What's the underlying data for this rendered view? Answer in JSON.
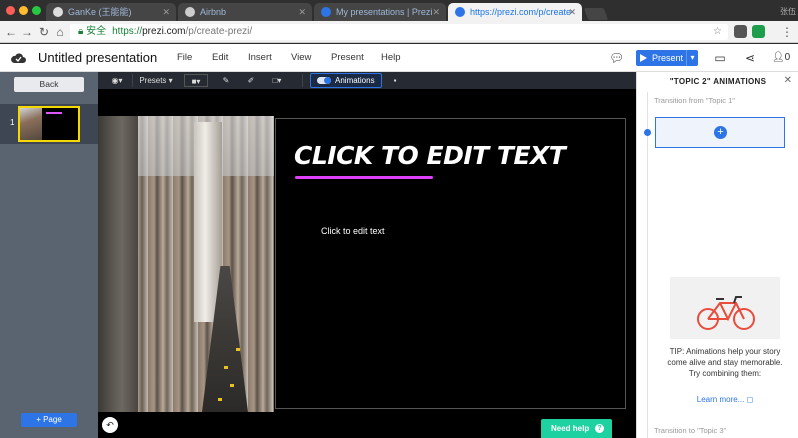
{
  "browser": {
    "tabs": [
      {
        "label": "GanKe (王能能)",
        "active": false
      },
      {
        "label": "Airbnb",
        "active": false
      },
      {
        "label": "My presentations | Prezi",
        "active": false
      },
      {
        "label": "https://prezi.com/p/create",
        "active": true
      }
    ],
    "user_label": "张伍",
    "url_secure_label": "安全",
    "url_proto": "https://",
    "url_host": "prezi.com",
    "url_path": "/p/create-prezi/"
  },
  "app": {
    "title": "Untitled presentation",
    "menu": [
      "File",
      "Edit",
      "Insert",
      "View",
      "Present",
      "Help"
    ],
    "present_label": "Present",
    "collab_count": "0"
  },
  "left_panel": {
    "back_label": "Back",
    "slide_number": "1",
    "add_page_label": "+ Page"
  },
  "toolbar": {
    "presets_label": "Presets",
    "animations_label": "Animations"
  },
  "slide": {
    "title": "CLICK TO EDIT TEXT",
    "body": "Click to edit text"
  },
  "help": {
    "label": "Need help"
  },
  "animations_panel": {
    "title": "\"TOPIC 2\" ANIMATIONS",
    "transition_from": "Transition from \"Topic 1\"",
    "tip": "TIP: Animations help your story come alive and stay memorable.",
    "tip2": "Try combining them:",
    "learn_more": "Learn more...",
    "transition_to": "Transition to \"Topic 3\""
  },
  "colors": {
    "accent": "#2d75e6",
    "title_underline": "#e040fb",
    "help_button": "#1dd1a1",
    "selection_border": "#f5d800"
  }
}
